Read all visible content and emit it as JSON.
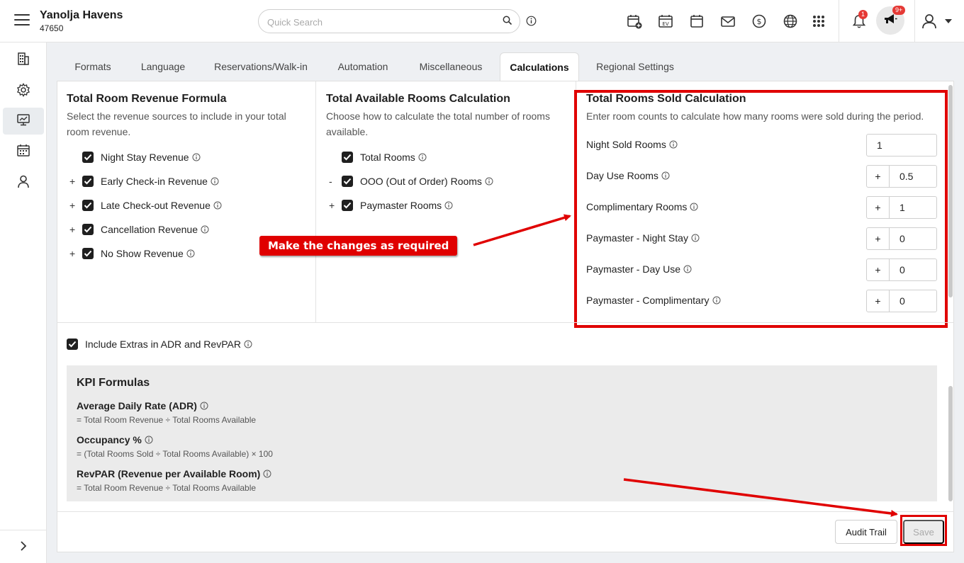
{
  "header": {
    "property_name": "Yanolja Havens",
    "property_id": "47650",
    "search_placeholder": "Quick Search",
    "notifications_badge": "1",
    "announcements_badge": "9+"
  },
  "tabs": [
    {
      "label": "Formats"
    },
    {
      "label": "Language"
    },
    {
      "label": "Reservations/Walk-in"
    },
    {
      "label": "Automation"
    },
    {
      "label": "Miscellaneous"
    },
    {
      "label": "Calculations"
    },
    {
      "label": "Regional Settings"
    }
  ],
  "revenue": {
    "title": "Total Room Revenue Formula",
    "subtitle": "Select the revenue sources to include in your total room revenue.",
    "items": [
      {
        "op": "",
        "label": "Night Stay Revenue"
      },
      {
        "op": "+",
        "label": "Early Check-in Revenue"
      },
      {
        "op": "+",
        "label": "Late Check-out Revenue"
      },
      {
        "op": "+",
        "label": "Cancellation Revenue"
      },
      {
        "op": "+",
        "label": "No Show Revenue"
      }
    ]
  },
  "available": {
    "title": "Total Available Rooms Calculation",
    "subtitle": "Choose how to calculate the total number of rooms available.",
    "items": [
      {
        "op": "",
        "label": "Total Rooms"
      },
      {
        "op": "-",
        "label": "OOO (Out of Order) Rooms"
      },
      {
        "op": "+",
        "label": "Paymaster Rooms"
      }
    ]
  },
  "sold": {
    "title": "Total Rooms Sold Calculation",
    "subtitle": "Enter room counts to calculate how many rooms were sold during the period.",
    "fields": [
      {
        "label": "Night Sold Rooms",
        "op": "",
        "value": "1"
      },
      {
        "label": "Day Use Rooms",
        "op": "+",
        "value": "0.5"
      },
      {
        "label": "Complimentary Rooms",
        "op": "+",
        "value": "1"
      },
      {
        "label": "Paymaster - Night Stay",
        "op": "+",
        "value": "0"
      },
      {
        "label": "Paymaster - Day Use",
        "op": "+",
        "value": "0"
      },
      {
        "label": "Paymaster - Complimentary",
        "op": "+",
        "value": "0"
      }
    ]
  },
  "extras_label": "Include Extras in ADR and RevPAR",
  "kpi": {
    "title": "KPI Formulas",
    "items": [
      {
        "name": "Average Daily Rate (ADR)",
        "formula": "= Total Room Revenue ÷ Total Rooms Available"
      },
      {
        "name": "Occupancy %",
        "formula": "= (Total Rooms Sold ÷ Total Rooms Available) × 100"
      },
      {
        "name": "RevPAR (Revenue per Available Room)",
        "formula": "= Total Room Revenue ÷ Total Rooms Available"
      }
    ]
  },
  "footer": {
    "audit_label": "Audit Trail",
    "save_label": "Save"
  },
  "annotation": {
    "callout_text": "Make the changes as required",
    "color": "#e00000"
  }
}
